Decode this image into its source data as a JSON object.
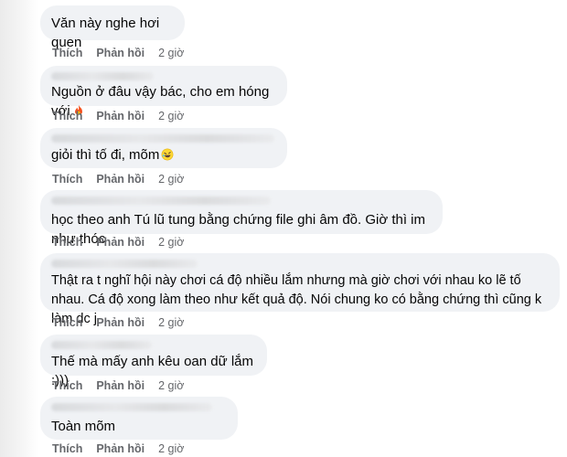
{
  "comments": [
    {
      "text": "Văn này nghe hơi quen",
      "like": "Thích",
      "reply": "Phản hồi",
      "time": "2 giờ"
    },
    {
      "text": "Nguồn ở đâu vậy bác, cho em hóng với",
      "emoji": "fire-icon",
      "like": "Thích",
      "reply": "Phản hồi",
      "time": "2 giờ"
    },
    {
      "text": "giỏi thì tố đi, mõm",
      "emoji": "rolling-laugh-icon",
      "like": "Thích",
      "reply": "Phản hồi",
      "time": "2 giờ"
    },
    {
      "text": "học theo anh Tú lũ tung bằng chứng file ghi âm đồ. Giờ thì im như thóc",
      "like": "Thích",
      "reply": "Phản hồi",
      "time": "2 giờ"
    },
    {
      "text": "Thật ra t nghĩ hội này chơi cá độ nhiều lắm nhưng mà giờ chơi với nhau ko lẽ tố nhau. Cá độ xong làm theo như kết quả độ. Nói chung ko có bằng chứng thì cũng k làm dc j",
      "like": "Thích",
      "reply": "Phản hồi",
      "time": "2 giờ"
    },
    {
      "text": "Thế mà mấy anh kêu oan dữ lắm :)))",
      "like": "Thích",
      "reply": "Phản hồi",
      "time": "2 giờ"
    },
    {
      "text": "Toàn mõm",
      "like": "Thích",
      "reply": "Phản hồi",
      "time": "2 giờ"
    }
  ]
}
